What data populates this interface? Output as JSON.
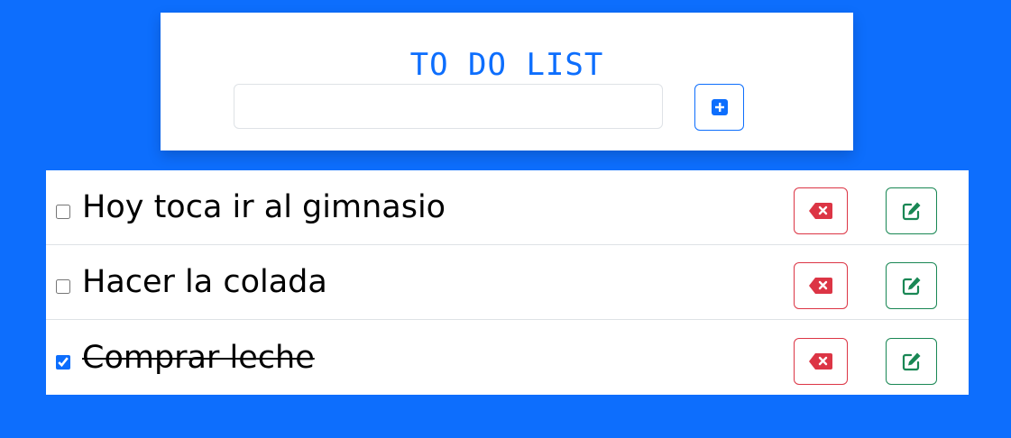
{
  "header": {
    "title": "TO DO LIST",
    "input_value": "",
    "input_placeholder": "",
    "add_button_icon": "plus-square-icon"
  },
  "tasks": [
    {
      "text": "Hoy toca ir al gimnasio",
      "completed": false
    },
    {
      "text": "Hacer la colada",
      "completed": false
    },
    {
      "text": "Comprar leche",
      "completed": true
    }
  ],
  "task_actions": {
    "delete_icon": "backspace-x-icon",
    "edit_icon": "pencil-square-icon"
  },
  "colors": {
    "background": "#0d6efd",
    "primary": "#0d6efd",
    "danger": "#dc3545",
    "success": "#198754"
  }
}
